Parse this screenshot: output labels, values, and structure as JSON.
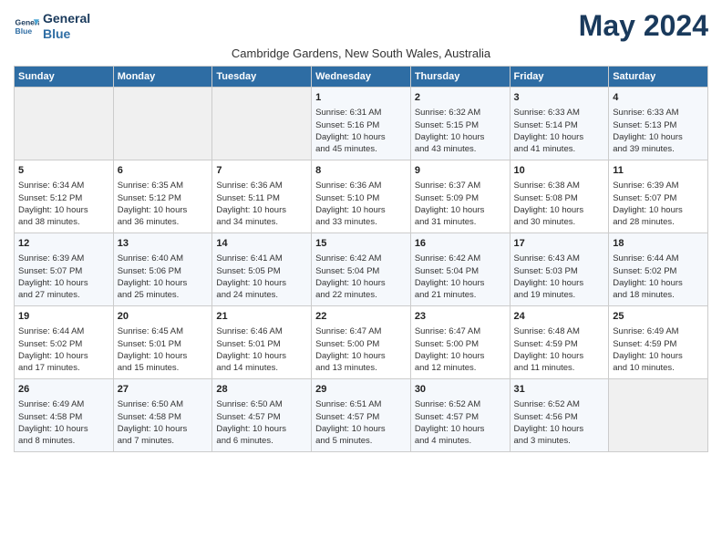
{
  "app": {
    "logo_line1": "General",
    "logo_line2": "Blue",
    "title": "May 2024",
    "subtitle": "Cambridge Gardens, New South Wales, Australia"
  },
  "calendar": {
    "headers": [
      "Sunday",
      "Monday",
      "Tuesday",
      "Wednesday",
      "Thursday",
      "Friday",
      "Saturday"
    ],
    "weeks": [
      [
        {
          "day": "",
          "info": ""
        },
        {
          "day": "",
          "info": ""
        },
        {
          "day": "",
          "info": ""
        },
        {
          "day": "1",
          "info": "Sunrise: 6:31 AM\nSunset: 5:16 PM\nDaylight: 10 hours\nand 45 minutes."
        },
        {
          "day": "2",
          "info": "Sunrise: 6:32 AM\nSunset: 5:15 PM\nDaylight: 10 hours\nand 43 minutes."
        },
        {
          "day": "3",
          "info": "Sunrise: 6:33 AM\nSunset: 5:14 PM\nDaylight: 10 hours\nand 41 minutes."
        },
        {
          "day": "4",
          "info": "Sunrise: 6:33 AM\nSunset: 5:13 PM\nDaylight: 10 hours\nand 39 minutes."
        }
      ],
      [
        {
          "day": "5",
          "info": "Sunrise: 6:34 AM\nSunset: 5:12 PM\nDaylight: 10 hours\nand 38 minutes."
        },
        {
          "day": "6",
          "info": "Sunrise: 6:35 AM\nSunset: 5:12 PM\nDaylight: 10 hours\nand 36 minutes."
        },
        {
          "day": "7",
          "info": "Sunrise: 6:36 AM\nSunset: 5:11 PM\nDaylight: 10 hours\nand 34 minutes."
        },
        {
          "day": "8",
          "info": "Sunrise: 6:36 AM\nSunset: 5:10 PM\nDaylight: 10 hours\nand 33 minutes."
        },
        {
          "day": "9",
          "info": "Sunrise: 6:37 AM\nSunset: 5:09 PM\nDaylight: 10 hours\nand 31 minutes."
        },
        {
          "day": "10",
          "info": "Sunrise: 6:38 AM\nSunset: 5:08 PM\nDaylight: 10 hours\nand 30 minutes."
        },
        {
          "day": "11",
          "info": "Sunrise: 6:39 AM\nSunset: 5:07 PM\nDaylight: 10 hours\nand 28 minutes."
        }
      ],
      [
        {
          "day": "12",
          "info": "Sunrise: 6:39 AM\nSunset: 5:07 PM\nDaylight: 10 hours\nand 27 minutes."
        },
        {
          "day": "13",
          "info": "Sunrise: 6:40 AM\nSunset: 5:06 PM\nDaylight: 10 hours\nand 25 minutes."
        },
        {
          "day": "14",
          "info": "Sunrise: 6:41 AM\nSunset: 5:05 PM\nDaylight: 10 hours\nand 24 minutes."
        },
        {
          "day": "15",
          "info": "Sunrise: 6:42 AM\nSunset: 5:04 PM\nDaylight: 10 hours\nand 22 minutes."
        },
        {
          "day": "16",
          "info": "Sunrise: 6:42 AM\nSunset: 5:04 PM\nDaylight: 10 hours\nand 21 minutes."
        },
        {
          "day": "17",
          "info": "Sunrise: 6:43 AM\nSunset: 5:03 PM\nDaylight: 10 hours\nand 19 minutes."
        },
        {
          "day": "18",
          "info": "Sunrise: 6:44 AM\nSunset: 5:02 PM\nDaylight: 10 hours\nand 18 minutes."
        }
      ],
      [
        {
          "day": "19",
          "info": "Sunrise: 6:44 AM\nSunset: 5:02 PM\nDaylight: 10 hours\nand 17 minutes."
        },
        {
          "day": "20",
          "info": "Sunrise: 6:45 AM\nSunset: 5:01 PM\nDaylight: 10 hours\nand 15 minutes."
        },
        {
          "day": "21",
          "info": "Sunrise: 6:46 AM\nSunset: 5:01 PM\nDaylight: 10 hours\nand 14 minutes."
        },
        {
          "day": "22",
          "info": "Sunrise: 6:47 AM\nSunset: 5:00 PM\nDaylight: 10 hours\nand 13 minutes."
        },
        {
          "day": "23",
          "info": "Sunrise: 6:47 AM\nSunset: 5:00 PM\nDaylight: 10 hours\nand 12 minutes."
        },
        {
          "day": "24",
          "info": "Sunrise: 6:48 AM\nSunset: 4:59 PM\nDaylight: 10 hours\nand 11 minutes."
        },
        {
          "day": "25",
          "info": "Sunrise: 6:49 AM\nSunset: 4:59 PM\nDaylight: 10 hours\nand 10 minutes."
        }
      ],
      [
        {
          "day": "26",
          "info": "Sunrise: 6:49 AM\nSunset: 4:58 PM\nDaylight: 10 hours\nand 8 minutes."
        },
        {
          "day": "27",
          "info": "Sunrise: 6:50 AM\nSunset: 4:58 PM\nDaylight: 10 hours\nand 7 minutes."
        },
        {
          "day": "28",
          "info": "Sunrise: 6:50 AM\nSunset: 4:57 PM\nDaylight: 10 hours\nand 6 minutes."
        },
        {
          "day": "29",
          "info": "Sunrise: 6:51 AM\nSunset: 4:57 PM\nDaylight: 10 hours\nand 5 minutes."
        },
        {
          "day": "30",
          "info": "Sunrise: 6:52 AM\nSunset: 4:57 PM\nDaylight: 10 hours\nand 4 minutes."
        },
        {
          "day": "31",
          "info": "Sunrise: 6:52 AM\nSunset: 4:56 PM\nDaylight: 10 hours\nand 3 minutes."
        },
        {
          "day": "",
          "info": ""
        }
      ]
    ]
  }
}
